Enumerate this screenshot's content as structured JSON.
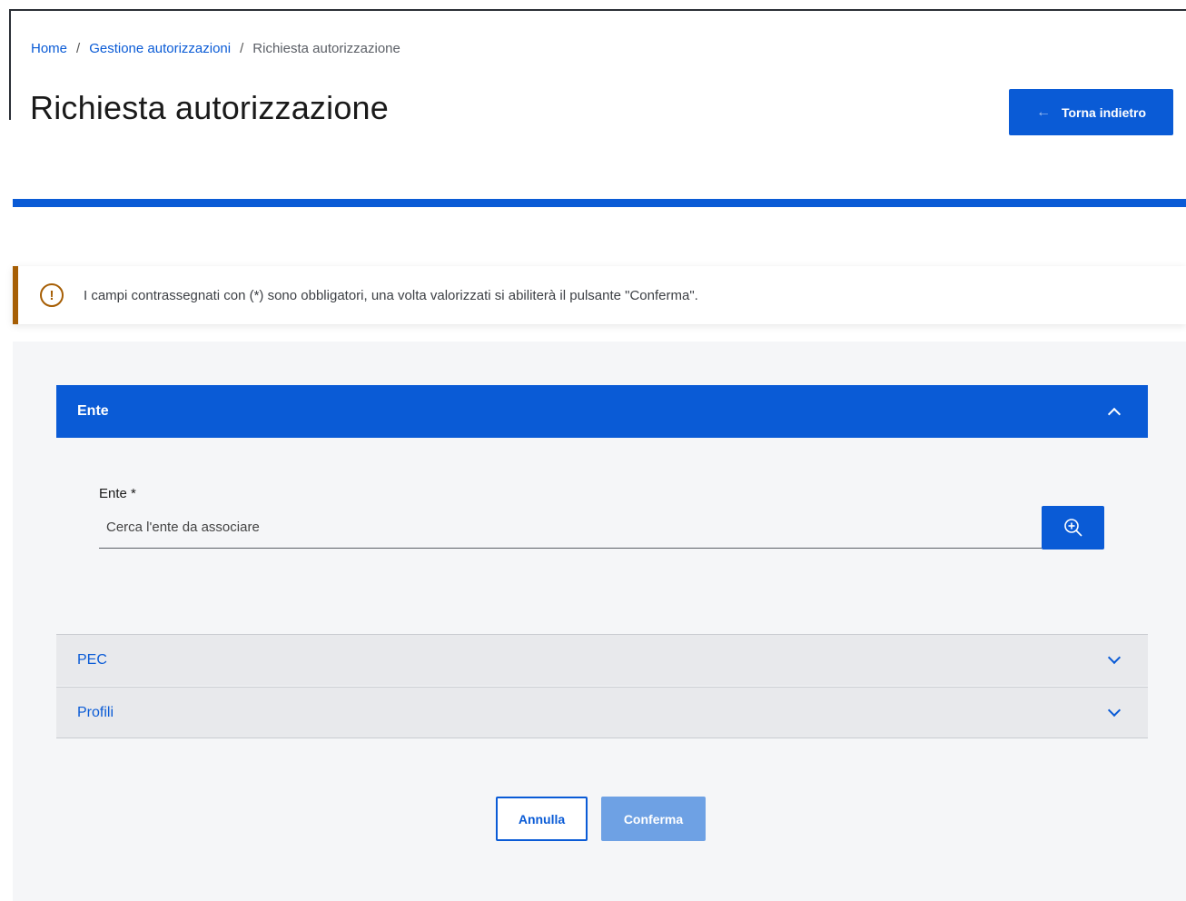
{
  "breadcrumb": {
    "home": "Home",
    "separator": "/",
    "gestione": "Gestione autorizzazioni",
    "current": "Richiesta autorizzazione"
  },
  "header": {
    "title": "Richiesta autorizzazione",
    "back_button_arrow": "←",
    "back_button_label": "Torna indietro"
  },
  "alert": {
    "icon": "warning-circle-icon",
    "icon_glyph": "!",
    "text": "I campi contrassegnati con (*) sono obbligatori, una volta valorizzati si abiliterà il pulsante \"Conferma\"."
  },
  "accordion": {
    "ente": {
      "label": "Ente",
      "expanded": true,
      "field_label": "Ente *",
      "field_placeholder": "Cerca l'ente da associare",
      "field_value": "",
      "search_icon": "zoom-in-search-icon"
    },
    "pec": {
      "label": "PEC",
      "expanded": false
    },
    "profili": {
      "label": "Profili",
      "expanded": false
    }
  },
  "actions": {
    "cancel_label": "Annulla",
    "confirm_label": "Conferma",
    "confirm_enabled": false
  },
  "colors": {
    "primary": "#0a5bd6",
    "primary_disabled": "#6ea1e4",
    "warning": "#a65e04",
    "panel_bg": "#f5f6f8"
  }
}
